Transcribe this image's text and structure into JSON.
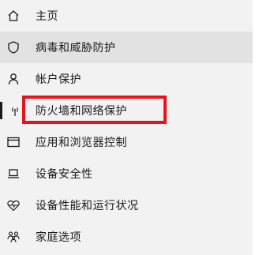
{
  "sidebar": {
    "items": [
      {
        "label": "主页",
        "icon": "home-icon"
      },
      {
        "label": "病毒和威胁防护",
        "icon": "shield-icon"
      },
      {
        "label": "帐户保护",
        "icon": "person-icon"
      },
      {
        "label": "防火墙和网络保护",
        "icon": "wifi-antenna-icon"
      },
      {
        "label": "应用和浏览器控制",
        "icon": "browser-window-icon"
      },
      {
        "label": "设备安全性",
        "icon": "laptop-icon"
      },
      {
        "label": "设备性能和运行状况",
        "icon": "heart-pulse-icon"
      },
      {
        "label": "家庭选项",
        "icon": "family-icon"
      }
    ]
  },
  "colors": {
    "highlight": "#e8131a",
    "background": "#f2f2f2",
    "selected_background": "#e2e2e2",
    "text": "#1a1a1a"
  }
}
